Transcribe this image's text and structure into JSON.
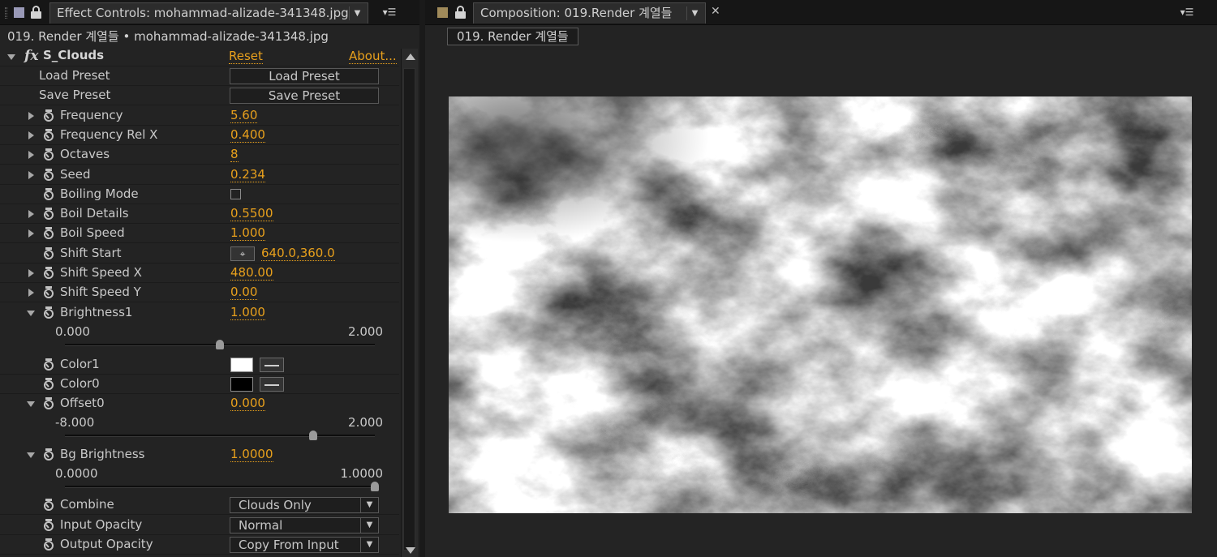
{
  "effect_controls": {
    "tab_title": "Effect Controls: mohammad-alizade-341348.jpg",
    "layer_path": "019. Render 계열들 • mohammad-alizade-341348.jpg",
    "effect": {
      "name": "S_Clouds",
      "reset_label": "Reset",
      "about_label": "About...",
      "load_preset_label": "Load Preset",
      "load_preset_button": "Load Preset",
      "save_preset_label": "Save Preset",
      "save_preset_button": "Save Preset"
    },
    "params": {
      "frequency": {
        "label": "Frequency",
        "value": "5.60"
      },
      "frequency_rel_x": {
        "label": "Frequency Rel X",
        "value": "0.400"
      },
      "octaves": {
        "label": "Octaves",
        "value": "8"
      },
      "seed": {
        "label": "Seed",
        "value": "0.234"
      },
      "boiling_mode": {
        "label": "Boiling Mode",
        "checked": false
      },
      "boil_details": {
        "label": "Boil Details",
        "value": "0.5500"
      },
      "boil_speed": {
        "label": "Boil Speed",
        "value": "1.000"
      },
      "shift_start": {
        "label": "Shift Start",
        "value": "640.0,360.0"
      },
      "shift_speed_x": {
        "label": "Shift Speed X",
        "value": "480.00"
      },
      "shift_speed_y": {
        "label": "Shift Speed Y",
        "value": "0.00"
      },
      "brightness1": {
        "label": "Brightness1",
        "value": "1.000",
        "slider_min": "0.000",
        "slider_max": "2.000",
        "slider_fraction": 0.5
      },
      "color1": {
        "label": "Color1",
        "color": "#ffffff"
      },
      "color0": {
        "label": "Color0",
        "color": "#000000"
      },
      "offset0": {
        "label": "Offset0",
        "value": "0.000",
        "slider_min": "-8.000",
        "slider_max": "2.000",
        "slider_fraction": 0.8
      },
      "bg_brightness": {
        "label": "Bg Brightness",
        "value": "1.0000",
        "slider_min": "0.0000",
        "slider_max": "1.0000",
        "slider_fraction": 1.0
      },
      "combine": {
        "label": "Combine",
        "value": "Clouds Only"
      },
      "input_opacity": {
        "label": "Input Opacity",
        "value": "Normal"
      },
      "output_opacity": {
        "label": "Output Opacity",
        "value": "Copy From Input"
      }
    }
  },
  "composition": {
    "tab_title": "Composition: 019.Render 계열들",
    "comp_name": "019. Render 계열들"
  },
  "colors": {
    "accent": "#e8a01c",
    "panel_bg": "#232323",
    "tab_bar_bg": "#161616"
  },
  "icons": {
    "panel_menu": "panel-menu-icon",
    "lock": "lock-icon",
    "stopwatch": "stopwatch-icon",
    "twirl": "twirl-triangle-icon",
    "eyedropper": "eyedropper-icon",
    "crosshair": "crosshair-icon"
  }
}
